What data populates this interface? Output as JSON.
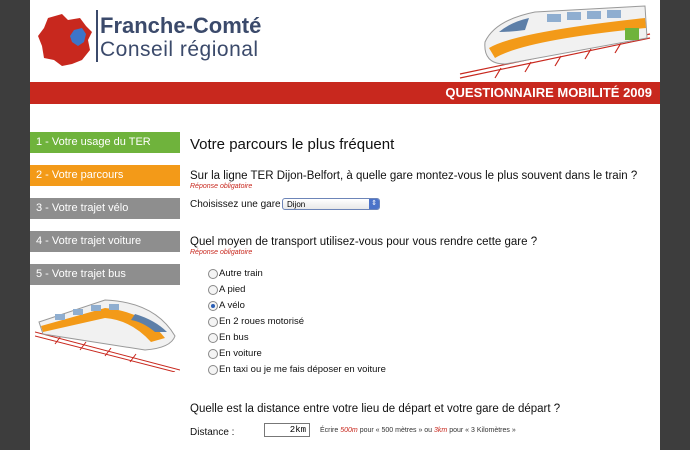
{
  "header": {
    "brand_line1": "Franche-Comté",
    "brand_line2": "Conseil régional",
    "survey_title": "QUESTIONNAIRE MOBILITÉ 2009"
  },
  "sidebar": {
    "items": [
      {
        "label": "1 - Votre usage du TER",
        "state": "done"
      },
      {
        "label": "2 - Votre parcours",
        "state": "active"
      },
      {
        "label": "3 - Votre trajet vélo",
        "state": "pending"
      },
      {
        "label": "4 - Votre trajet voiture",
        "state": "pending"
      },
      {
        "label": "5 - Votre trajet bus",
        "state": "pending"
      }
    ]
  },
  "main": {
    "title": "Votre parcours le plus fréquent",
    "q1": "Sur la ligne TER Dijon-Belfort, à quelle gare montez-vous le plus souvent dans le train ?",
    "required": "Réponse obligatoire",
    "station_label": "Choisissez une gare :",
    "station_value": "Dijon",
    "q2": "Quel moyen de transport utilisez-vous pour vous rendre cette gare ?",
    "transport_options": [
      "Autre train",
      "A pied",
      "A vélo",
      "En 2 roues motorisé",
      "En bus",
      "En voiture",
      "En taxi ou je me fais déposer en voiture"
    ],
    "transport_selected": "A vélo",
    "q3": "Quelle est la distance entre votre lieu de départ et votre gare de départ ?",
    "distance_label": "Distance :",
    "distance_value": "2km",
    "hint_pre": "Écrire ",
    "hint_ex1": "500m",
    "hint_mid": " pour « 500 mètres » ou ",
    "hint_ex2": "3km",
    "hint_post": " pour « 3 Kilomètres »"
  },
  "colors": {
    "brand_red": "#c8281e",
    "nav_done": "#6fb33c",
    "nav_active": "#f39a18",
    "nav_pending": "#8e8e8e"
  }
}
